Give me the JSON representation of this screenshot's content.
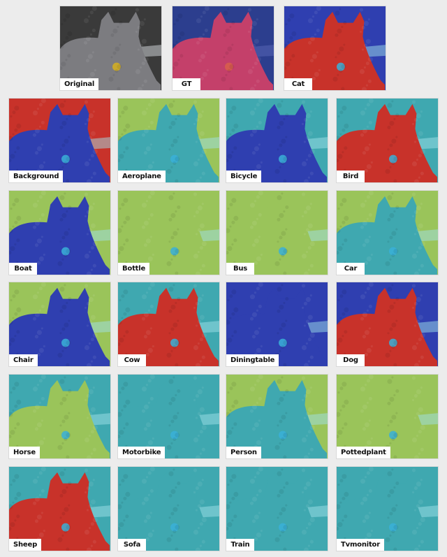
{
  "figure": {
    "top_row": [
      {
        "label": "Original",
        "kind": "photo"
      },
      {
        "label": "GT",
        "kind": "mask"
      },
      {
        "label": "Cat",
        "kind": "heatmap",
        "cat_level": "high",
        "bg_level": "low"
      }
    ],
    "grid": [
      {
        "label": "Background",
        "cat_level": "low",
        "bg_level": "high"
      },
      {
        "label": "Aeroplane",
        "cat_level": "mid-low",
        "bg_level": "mid"
      },
      {
        "label": "Bicycle",
        "cat_level": "low",
        "bg_level": "mid-low"
      },
      {
        "label": "Bird",
        "cat_level": "high",
        "bg_level": "mid-low"
      },
      {
        "label": "Boat",
        "cat_level": "low",
        "bg_level": "mid"
      },
      {
        "label": "Bottle",
        "cat_level": "mid",
        "bg_level": "mid"
      },
      {
        "label": "Bus",
        "cat_level": "mid",
        "bg_level": "mid"
      },
      {
        "label": "Car",
        "cat_level": "mid-low",
        "bg_level": "mid"
      },
      {
        "label": "Chair",
        "cat_level": "low",
        "bg_level": "mid"
      },
      {
        "label": "Cow",
        "cat_level": "high",
        "bg_level": "mid-low"
      },
      {
        "label": "Diningtable",
        "cat_level": "low",
        "bg_level": "low"
      },
      {
        "label": "Dog",
        "cat_level": "high",
        "bg_level": "low"
      },
      {
        "label": "Horse",
        "cat_level": "mid",
        "bg_level": "mid-low"
      },
      {
        "label": "Motorbike",
        "cat_level": "mid-low",
        "bg_level": "mid-low"
      },
      {
        "label": "Person",
        "cat_level": "mid-low",
        "bg_level": "mid"
      },
      {
        "label": "Pottedplant",
        "cat_level": "mid",
        "bg_level": "mid"
      },
      {
        "label": "Sheep",
        "cat_level": "high",
        "bg_level": "mid-low"
      },
      {
        "label": "Sofa",
        "cat_level": "mid-low",
        "bg_level": "mid-low"
      },
      {
        "label": "Train",
        "cat_level": "mid-low",
        "bg_level": "mid-low"
      },
      {
        "label": "Tvmonitor",
        "cat_level": "mid-low",
        "bg_level": "mid-low"
      }
    ],
    "colors": {
      "background": "#ececec",
      "label_bg": "#ffffff",
      "label_text": "#111111",
      "gt_background": "#2c3e8e",
      "gt_mask": "#c4406a",
      "heat_low": "#2f3fb0",
      "heat_midlow": "#3fa8b0",
      "heat_mid": "#9ac45a",
      "heat_high": "#c8322a"
    }
  }
}
